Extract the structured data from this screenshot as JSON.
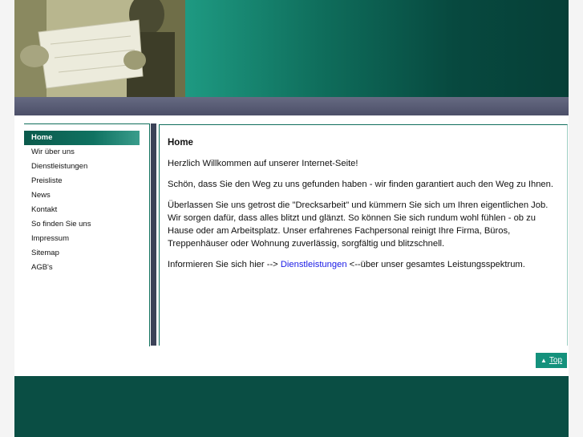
{
  "nav": {
    "items": [
      {
        "label": "Home",
        "active": true
      },
      {
        "label": "Wir über uns",
        "active": false
      },
      {
        "label": "Dienstleistungen",
        "active": false
      },
      {
        "label": "Preisliste",
        "active": false
      },
      {
        "label": "News",
        "active": false
      },
      {
        "label": "Kontakt",
        "active": false
      },
      {
        "label": "So finden Sie uns",
        "active": false
      },
      {
        "label": "Impressum",
        "active": false
      },
      {
        "label": "Sitemap",
        "active": false
      },
      {
        "label": "AGB's",
        "active": false
      }
    ]
  },
  "content": {
    "title": "Home",
    "p1": "Herzlich Willkommen auf unserer Internet-Seite!",
    "p2": "Schön, dass Sie den Weg zu uns gefunden haben - wir finden garantiert auch den Weg zu Ihnen.",
    "p3": "Überlassen Sie uns getrost die \"Drecksarbeit\" und kümmern Sie sich um Ihren eigentlichen Job. Wir sorgen dafür, dass alles blitzt und glänzt. So können Sie sich rundum wohl fühlen - ob zu Hause oder am Arbeitsplatz. Unser erfahrenes Fachpersonal reinigt Ihre Firma, Büros, Treppenhäuser oder Wohnung zuverlässig, sorgfältig und blitzschnell.",
    "p4_before": "Informieren Sie sich hier --> ",
    "p4_link": "Dienstleistungen",
    "p4_after": " <--über unser gesamtes Leistungsspektrum."
  },
  "top_button": {
    "label": "Top",
    "icon": "chevron-up-icon"
  },
  "colors": {
    "accent": "#0f6e5c",
    "nav_active": "#0b5a4c",
    "header_bar": "#4c4f68",
    "footer": "#0a4e44",
    "link": "#1a1ae6"
  }
}
